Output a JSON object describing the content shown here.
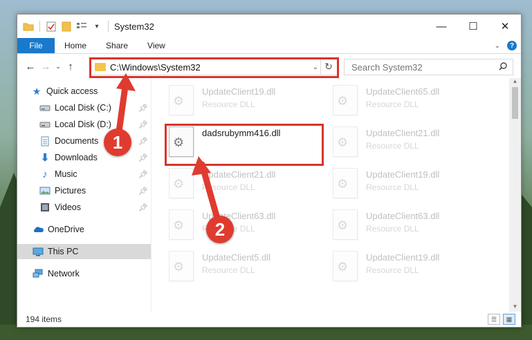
{
  "window": {
    "title": "System32"
  },
  "titlebar": {
    "minimize": "—",
    "maximize": "☐",
    "close": "✕"
  },
  "ribbon": {
    "tabs": [
      "File",
      "Home",
      "Share",
      "View"
    ]
  },
  "address": {
    "path": "C:\\Windows\\System32"
  },
  "search": {
    "placeholder": "Search System32"
  },
  "sidebar": {
    "items": [
      {
        "label": "Quick access",
        "icon": "star-icon"
      },
      {
        "label": "Local Disk (C:)",
        "icon": "drive-icon",
        "pinned": true
      },
      {
        "label": "Local Disk (D:)",
        "icon": "drive-icon",
        "pinned": true
      },
      {
        "label": "Documents",
        "icon": "documents-icon",
        "pinned": true
      },
      {
        "label": "Downloads",
        "icon": "downloads-icon",
        "pinned": true
      },
      {
        "label": "Music",
        "icon": "music-icon",
        "pinned": true
      },
      {
        "label": "Pictures",
        "icon": "pictures-icon",
        "pinned": true
      },
      {
        "label": "Videos",
        "icon": "videos-icon",
        "pinned": true
      },
      {
        "label": "OneDrive",
        "icon": "onedrive-icon"
      },
      {
        "label": "This PC",
        "icon": "pc-icon",
        "selected": true
      },
      {
        "label": "Network",
        "icon": "network-icon"
      }
    ]
  },
  "files": [
    {
      "name": "UpdateClient19.dll",
      "desc": "Resource DLL"
    },
    {
      "name": "UpdateClient65.dll",
      "desc": "Resource DLL"
    },
    {
      "name": "dadsrubymm416.dll",
      "desc": ""
    },
    {
      "name": "UpdateClient21.dll",
      "desc": "Resource DLL"
    },
    {
      "name": "UpdateClient21.dll",
      "desc": "Resource DLL"
    },
    {
      "name": "UpdateClient19.dll",
      "desc": "Resource DLL"
    },
    {
      "name": "UpdateClient63.dll",
      "desc": "Resource DLL"
    },
    {
      "name": "UpdateClient63.dll",
      "desc": "Resource DLL"
    },
    {
      "name": "UpdateClient5.dll",
      "desc": "Resource DLL"
    },
    {
      "name": "UpdateClient19.dll",
      "desc": "Resource DLL"
    }
  ],
  "status": {
    "item_count": "194 items"
  },
  "callouts": {
    "step1": "1",
    "step2": "2"
  },
  "colors": {
    "accent": "#1979ca",
    "highlight": "#d9342b",
    "badge": "#e03b2f"
  }
}
